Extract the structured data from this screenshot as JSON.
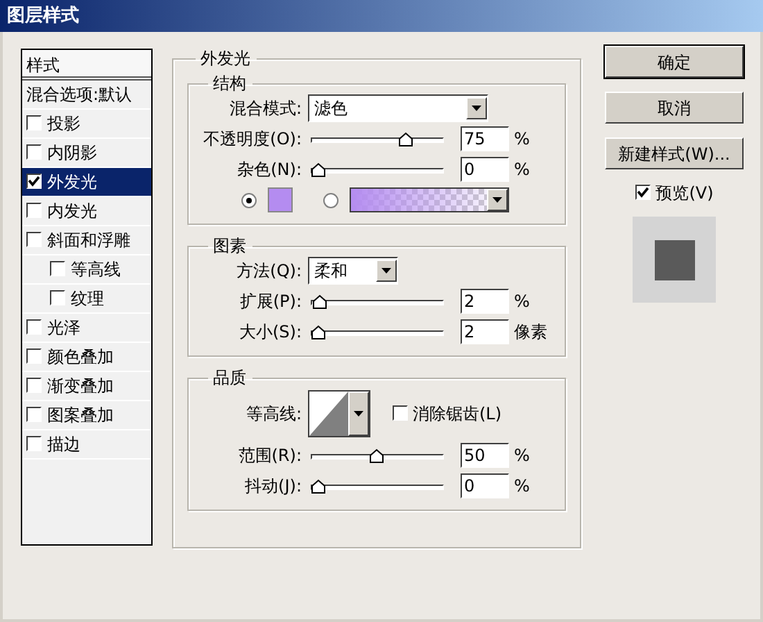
{
  "window": {
    "title": "图层样式"
  },
  "styles_panel": {
    "header": "样式",
    "items": [
      {
        "label": "混合选项:默认",
        "kind": "plain",
        "selected": false
      },
      {
        "label": "投影",
        "kind": "check",
        "checked": false,
        "selected": false
      },
      {
        "label": "内阴影",
        "kind": "check",
        "checked": false,
        "selected": false
      },
      {
        "label": "外发光",
        "kind": "check",
        "checked": true,
        "selected": true
      },
      {
        "label": "内发光",
        "kind": "check",
        "checked": false,
        "selected": false
      },
      {
        "label": "斜面和浮雕",
        "kind": "check",
        "checked": false,
        "selected": false,
        "children": [
          {
            "label": "等高线",
            "kind": "check",
            "checked": false,
            "selected": false
          },
          {
            "label": "纹理",
            "kind": "check",
            "checked": false,
            "selected": false
          }
        ]
      },
      {
        "label": "光泽",
        "kind": "check",
        "checked": false,
        "selected": false
      },
      {
        "label": "颜色叠加",
        "kind": "check",
        "checked": false,
        "selected": false
      },
      {
        "label": "渐变叠加",
        "kind": "check",
        "checked": false,
        "selected": false
      },
      {
        "label": "图案叠加",
        "kind": "check",
        "checked": false,
        "selected": false
      },
      {
        "label": "描边",
        "kind": "check",
        "checked": false,
        "selected": false
      }
    ]
  },
  "outer_glow": {
    "title": "外发光",
    "structure": {
      "title": "结构",
      "rows": [
        {
          "kind": "dropdown",
          "label": "混合模式:",
          "value": "滤色"
        },
        {
          "kind": "slider",
          "label": "不透明度(O):",
          "level": 0.75,
          "value": "75",
          "unit": "%"
        },
        {
          "kind": "slider",
          "label": "杂色(N):",
          "level": 0,
          "value": "0",
          "unit": "%"
        },
        {
          "kind": "source",
          "options": [
            {
              "kind": "solid",
              "selected": true,
              "color": "#b48cf0"
            },
            {
              "kind": "gradient",
              "selected": false,
              "color": "#b48cf0"
            }
          ]
        }
      ]
    },
    "elements": {
      "title": "图素",
      "rows": [
        {
          "kind": "dropdown",
          "label": "方法(Q):",
          "value": "柔和"
        },
        {
          "kind": "slider",
          "label": "扩展(P):",
          "level": 0.02,
          "value": "2",
          "unit": "%"
        },
        {
          "kind": "slider",
          "label": "大小(S):",
          "level": 0.01,
          "value": "2",
          "unit": "像素"
        }
      ]
    },
    "quality": {
      "title": "品质",
      "rows": [
        {
          "kind": "contour",
          "label": "等高线:",
          "antialias": {
            "label": "消除锯齿(L)",
            "checked": false
          }
        },
        {
          "kind": "slider",
          "label": "范围(R):",
          "level": 0.5,
          "value": "50",
          "unit": "%"
        },
        {
          "kind": "slider",
          "label": "抖动(J):",
          "level": 0,
          "value": "0",
          "unit": "%"
        }
      ]
    }
  },
  "buttons": [
    {
      "label": "确定",
      "default": true
    },
    {
      "label": "取消",
      "default": false
    },
    {
      "label": "新建样式(W)...",
      "default": false
    }
  ],
  "preview": {
    "label": "预览(V)",
    "checked": true
  }
}
